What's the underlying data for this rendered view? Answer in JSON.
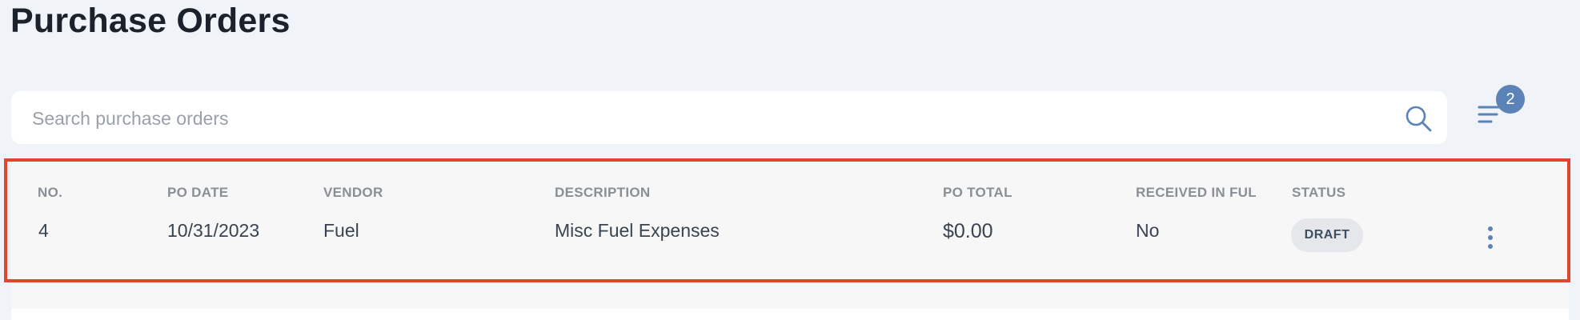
{
  "page": {
    "title": "Purchase Orders"
  },
  "search": {
    "placeholder": "Search purchase orders",
    "value": ""
  },
  "filter": {
    "badge_count": "2",
    "icon": "filter-lines-icon"
  },
  "table": {
    "columns": [
      "NO.",
      "PO DATE",
      "VENDOR",
      "DESCRIPTION",
      "PO TOTAL",
      "RECEIVED IN FUL",
      "STATUS"
    ],
    "rows": [
      {
        "no": "4",
        "po_date": "10/31/2023",
        "vendor": "Fuel",
        "description": "Misc Fuel Expenses",
        "po_total": "$0.00",
        "received_in_full": "No",
        "status": "DRAFT"
      }
    ]
  },
  "colors": {
    "background": "#f0f3f7",
    "accent_badge": "#5b83b8",
    "highlight_border": "#e0452e",
    "status_badge_bg": "#e6e7ea"
  }
}
